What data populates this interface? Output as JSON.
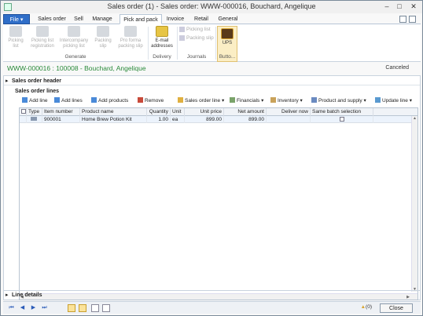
{
  "window": {
    "title": "Sales order (1) - Sales order: WWW-000016, Bouchard, Angelique"
  },
  "tabs": [
    "File",
    "Sales order",
    "Sell",
    "Manage",
    "Pick and pack",
    "Invoice",
    "Retail",
    "General"
  ],
  "ribbon": {
    "generate": {
      "buttons": [
        "Picking list",
        "Picking list registration",
        "Intercompany picking list",
        "Packing slip",
        "Pro forma packing slip"
      ],
      "label": "Generate"
    },
    "delivery": {
      "buttons": [
        "E-mail addresses"
      ],
      "label": "Delivery"
    },
    "journals": {
      "buttons": [
        "Picking list",
        "Packing slip"
      ],
      "label": "Journals"
    },
    "ups": {
      "buttons": [
        "UPS"
      ],
      "label": "Butto..."
    }
  },
  "record": {
    "title": "WWW-000016 : 100008 - Bouchard, Angelique",
    "status": "Canceled"
  },
  "sections": {
    "header": "Sales order header",
    "lines": "Sales order lines",
    "line_details": "Line details"
  },
  "lines_toolbar": [
    "Add line",
    "Add lines",
    "Add products",
    "Remove",
    "Sales order line ▾",
    "Financials ▾",
    "Inventory ▾",
    "Product and supply ▾",
    "Update line ▾"
  ],
  "grid": {
    "columns": [
      "Type",
      "Item number",
      "Product name",
      "Quantity",
      "Unit",
      "Unit price",
      "Net amount",
      "Deliver now",
      "Same batch selection"
    ],
    "rows": [
      {
        "item": "900001",
        "product": "Home Brew Potion Kit",
        "qty": "1.00",
        "unit": "ea",
        "price": "899.00",
        "net": "899.00",
        "deliver": ""
      }
    ]
  },
  "statusbar": {
    "alerts": "(0)",
    "close": "Close"
  },
  "colors": {
    "accent": "#2f6ec8",
    "record_title": "#2a8a3a",
    "ups_brown": "#5a3a1a",
    "ups_gold": "#d9a531"
  }
}
